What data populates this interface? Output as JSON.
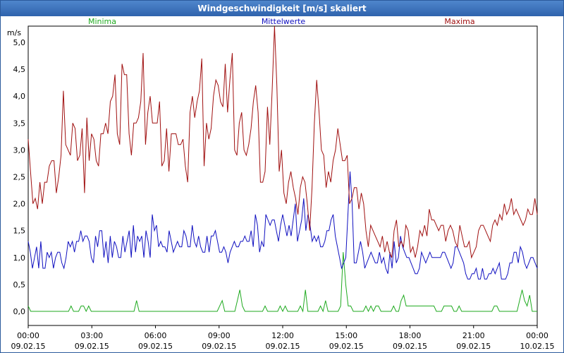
{
  "window": {
    "title": "Windgeschwindigkeit [m/s] skaliert"
  },
  "chart_data": {
    "type": "line",
    "title": "Windgeschwindigkeit [m/s] skaliert",
    "ylabel": "m/s",
    "ylim": [
      0,
      5.5
    ],
    "grid": true,
    "legend_position": "top",
    "y_ticks": [
      "0,0",
      "0,5",
      "1,0",
      "1,5",
      "2,0",
      "2,5",
      "3,0",
      "3,5",
      "4,0",
      "4,5",
      "5,0"
    ],
    "x_ticks": [
      {
        "time": "00:00",
        "date": "09.02.15"
      },
      {
        "time": "03:00",
        "date": "09.02.15"
      },
      {
        "time": "06:00",
        "date": "09.02.15"
      },
      {
        "time": "09:00",
        "date": "09.02.15"
      },
      {
        "time": "12:00",
        "date": "09.02.15"
      },
      {
        "time": "15:00",
        "date": "09.02.15"
      },
      {
        "time": "18:00",
        "date": "09.02.15"
      },
      {
        "time": "21:00",
        "date": "09.02.15"
      },
      {
        "time": "00:00",
        "date": "10.02.15"
      }
    ],
    "x_hours_range": [
      0,
      24
    ],
    "series": [
      {
        "name": "Minima",
        "color": "#1faa1f",
        "values": [
          0.1,
          0,
          0,
          0,
          0,
          0,
          0,
          0,
          0,
          0,
          0,
          0,
          0,
          0,
          0,
          0,
          0,
          0.1,
          0,
          0,
          0,
          0.1,
          0.1,
          0,
          0.1,
          0,
          0,
          0,
          0,
          0,
          0,
          0,
          0,
          0,
          0,
          0,
          0,
          0,
          0,
          0,
          0,
          0,
          0,
          0.2,
          0,
          0,
          0,
          0,
          0,
          0,
          0,
          0,
          0,
          0,
          0,
          0,
          0,
          0,
          0,
          0,
          0,
          0,
          0,
          0,
          0,
          0,
          0,
          0,
          0,
          0,
          0,
          0,
          0,
          0,
          0,
          0,
          0.1,
          0.2,
          0,
          0,
          0,
          0,
          0,
          0.2,
          0.4,
          0.1,
          0,
          0,
          0,
          0,
          0,
          0,
          0,
          0,
          0.1,
          0,
          0,
          0,
          0,
          0,
          0.1,
          0,
          0.1,
          0,
          0,
          0,
          0,
          0,
          0.1,
          0,
          0.4,
          0,
          0,
          0,
          0,
          0,
          0.1,
          0,
          0.2,
          0,
          0,
          0,
          0,
          0,
          0.1,
          1.1,
          0.5,
          0.1,
          0.1,
          0,
          0,
          0,
          0,
          0,
          0.1,
          0,
          0.1,
          0,
          0.1,
          0.1,
          0,
          0,
          0,
          0,
          0,
          0.1,
          0,
          0,
          0.2,
          0.3,
          0.1,
          0.1,
          0.1,
          0.1,
          0.1,
          0.1,
          0.1,
          0.1,
          0.1,
          0.1,
          0.1,
          0.1,
          0,
          0,
          0,
          0.1,
          0.1,
          0.1,
          0.1,
          0,
          0,
          0.1,
          0,
          0,
          0,
          0,
          0,
          0,
          0,
          0,
          0,
          0,
          0,
          0,
          0,
          0.1,
          0.1,
          0,
          0,
          0,
          0,
          0,
          0,
          0,
          0,
          0.2,
          0.4,
          0.2,
          0.1,
          0.3,
          0,
          0,
          0
        ],
        "values_note_hours": [
          0,
          0.125,
          0.25,
          0.375,
          0.5,
          0.625,
          0.75,
          0.875,
          1,
          1.125,
          1.25,
          1.375,
          1.5,
          1.625,
          1.75,
          1.875,
          2,
          2.125,
          2.25,
          2.375,
          2.5,
          2.625,
          2.75,
          2.875,
          3,
          3.125,
          3.25,
          3.375,
          3.5,
          3.625,
          3.75,
          3.875,
          4,
          4.125,
          4.25,
          4.375,
          4.5,
          4.625,
          4.75,
          4.875,
          5,
          5.125,
          5.25,
          5.375,
          5.5,
          5.625,
          5.75,
          5.875,
          6,
          6.125,
          6.25,
          6.375,
          6.5,
          6.625,
          6.75,
          6.875,
          7,
          7.125,
          7.25,
          7.375,
          7.5,
          7.625,
          7.75,
          7.875,
          8,
          8.125,
          8.25,
          8.375,
          8.5,
          8.625,
          8.75,
          8.875,
          9,
          9.125,
          9.25,
          9.375,
          9.5,
          9.625,
          9.75,
          9.875,
          10,
          10.125,
          10.25,
          10.375,
          10.5,
          10.625,
          10.75,
          10.875,
          11,
          11.125,
          11.25,
          11.375,
          11.5,
          11.625,
          11.75,
          11.875,
          12,
          12.125,
          12.25,
          12.375,
          12.5,
          12.625,
          12.75,
          12.875,
          13,
          13.125,
          13.25,
          13.375,
          13.5,
          13.625,
          13.75,
          13.875,
          14,
          14.125,
          14.25,
          14.375,
          14.5,
          14.625,
          14.75,
          14.875,
          15,
          15.125,
          15.25,
          15.375,
          15.5,
          15.625,
          15.75,
          15.875,
          16,
          16.125,
          16.25,
          16.375,
          16.5,
          16.625,
          16.75,
          16.875,
          17,
          17.125,
          17.25,
          17.375,
          17.5,
          17.625,
          17.75,
          17.875,
          18,
          18.125,
          18.25,
          18.375,
          18.5,
          18.625,
          18.75,
          18.875,
          19,
          19.125,
          19.25,
          19.375,
          19.5,
          19.625,
          19.75,
          19.875,
          20,
          20.125,
          20.25,
          20.375,
          20.5,
          20.625,
          20.75,
          20.875,
          21,
          21.125,
          21.25,
          21.375,
          21.5,
          21.625,
          21.75,
          21.875,
          22,
          22.125,
          22.25,
          22.375,
          22.5,
          22.625,
          22.75,
          22.875,
          23,
          23.125,
          23.25,
          23.375,
          23.5,
          23.625,
          23.75,
          23.875,
          24
        ]
      },
      {
        "name": "Mittelwerte",
        "color": "#1010c0",
        "values": [
          1.3,
          1.1,
          0.8,
          1.0,
          1.2,
          0.8,
          1.3,
          0.8,
          0.8,
          1.1,
          1.0,
          1.1,
          0.8,
          1.0,
          1.1,
          1.1,
          0.9,
          0.8,
          1.0,
          1.3,
          1.2,
          1.3,
          1.1,
          1.3,
          1.3,
          1.5,
          1.3,
          1.4,
          1.4,
          1.3,
          1.0,
          0.9,
          1.4,
          1.2,
          1.5,
          1.5,
          1.0,
          1.3,
          0.9,
          1.4,
          1.0,
          1.3,
          1.2,
          1.0,
          1.0,
          1.4,
          1.1,
          1.3,
          1.5,
          1.0,
          1.6,
          1.1,
          1.4,
          1.3,
          1.4,
          1.0,
          1.5,
          1.3,
          1.0,
          1.8,
          1.5,
          1.6,
          1.2,
          1.3,
          1.2,
          1.2,
          1.1,
          1.5,
          1.3,
          1.1,
          1.2,
          1.3,
          1.2,
          1.2,
          1.5,
          1.4,
          1.2,
          1.2,
          1.6,
          1.3,
          1.2,
          1.4,
          1.2,
          1.1,
          1.1,
          1.4,
          1.1,
          1.4,
          1.4,
          1.5,
          1.3,
          1.1,
          1.1,
          1.2,
          1.1,
          0.9,
          1.1,
          1.2,
          1.3,
          1.2,
          1.2,
          1.3,
          1.3,
          1.4,
          1.3,
          1.3,
          1.5,
          1.2,
          1.8,
          1.6,
          1.1,
          1.3,
          1.2,
          1.8,
          1.7,
          1.6,
          1.7,
          1.7,
          1.5,
          1.3,
          1.6,
          1.8,
          1.6,
          1.4,
          1.6,
          1.4,
          1.7,
          2.0,
          1.3,
          1.5,
          1.7,
          2.1,
          1.5,
          1.8,
          1.6,
          1.3,
          1.4,
          1.3,
          1.4,
          1.2,
          1.2,
          1.3,
          1.5,
          1.5,
          1.7,
          1.8,
          1.4,
          1.2,
          1.0,
          0.8,
          0.9,
          1.0,
          1.8,
          2.6,
          2.0,
          0.9,
          0.9,
          1.1,
          1.3,
          1.1,
          0.8,
          0.9,
          1.0,
          1.1,
          1.0,
          0.9,
          0.9,
          1.1,
          0.9,
          1.0,
          0.8,
          0.7,
          1.1,
          0.8,
          1.3,
          0.9,
          1.0,
          1.4,
          1.2,
          1.1,
          1.0,
          1.0,
          0.9,
          0.8,
          0.7,
          0.7,
          0.8,
          1.1,
          1.0,
          0.9,
          1.0,
          1.1,
          1.0,
          1.0,
          1.0,
          1.0,
          1.0,
          1.1,
          1.1,
          1.0,
          0.9,
          0.8,
          0.9,
          1.2,
          1.2,
          1.1,
          1.0,
          0.9,
          0.7,
          0.6,
          0.6,
          0.7,
          0.7,
          0.8,
          0.6,
          0.6,
          0.8,
          0.6,
          0.6,
          0.7,
          0.7,
          0.8,
          0.7,
          0.8,
          0.9,
          0.6,
          0.6,
          0.6,
          0.7,
          0.9,
          0.9,
          1.1,
          1.1,
          0.9,
          1.2,
          1.1,
          0.9,
          0.8,
          0.9,
          1.0,
          1.0,
          0.9,
          0.8
        ]
      },
      {
        "name": "Maxima",
        "color": "#a01010",
        "values": [
          3.2,
          2.6,
          2.0,
          2.1,
          1.9,
          2.4,
          2.0,
          2.4,
          2.4,
          2.7,
          2.8,
          2.8,
          2.2,
          2.5,
          2.9,
          4.1,
          3.1,
          3.0,
          2.9,
          3.5,
          3.4,
          2.8,
          2.9,
          3.4,
          2.2,
          3.6,
          2.8,
          3.3,
          3.2,
          2.8,
          2.7,
          3.3,
          3.3,
          3.5,
          3.3,
          3.9,
          4.0,
          4.4,
          3.3,
          3.1,
          4.6,
          4.4,
          4.4,
          3.3,
          2.9,
          3.5,
          3.5,
          3.6,
          3.9,
          4.8,
          3.1,
          3.7,
          4.0,
          3.5,
          3.5,
          3.5,
          3.9,
          2.7,
          2.8,
          3.4,
          2.6,
          3.3,
          3.3,
          3.3,
          3.1,
          3.1,
          3.2,
          2.7,
          2.4,
          3.7,
          4.0,
          3.6,
          3.9,
          4.1,
          4.7,
          2.7,
          3.5,
          3.2,
          3.4,
          4.0,
          4.3,
          4.2,
          3.9,
          3.8,
          4.6,
          3.7,
          4.3,
          4.8,
          3.0,
          2.9,
          3.5,
          3.7,
          3.0,
          2.9,
          3.1,
          3.4,
          3.9,
          4.2,
          3.7,
          2.4,
          2.4,
          2.6,
          3.8,
          3.1,
          4.1,
          5.3,
          4.2,
          2.6,
          3.0,
          2.2,
          2.0,
          2.4,
          2.6,
          2.3,
          2.1,
          1.8,
          2.3,
          2.5,
          2.4,
          2.0,
          1.5,
          2.3,
          3.5,
          4.3,
          3.7,
          3.0,
          2.9,
          2.3,
          2.6,
          2.4,
          2.8,
          3.0,
          3.4,
          3.1,
          2.8,
          2.8,
          2.9,
          2.0,
          2.1,
          2.3,
          2.3,
          1.9,
          2.2,
          2.0,
          1.5,
          1.2,
          1.6,
          1.5,
          1.4,
          1.3,
          1.2,
          1.4,
          1.1,
          1.3,
          1.1,
          1.0,
          1.5,
          1.7,
          1.2,
          1.3,
          1.2,
          1.6,
          1.5,
          1.1,
          1.2,
          1.0,
          1.2,
          1.5,
          1.4,
          1.6,
          1.4,
          1.9,
          1.7,
          1.7,
          1.6,
          1.5,
          1.6,
          1.6,
          1.3,
          1.5,
          1.6,
          1.5,
          1.3,
          1.2,
          1.6,
          1.4,
          1.2,
          1.2,
          1.3,
          1.0,
          1.1,
          1.2,
          1.5,
          1.6,
          1.6,
          1.5,
          1.4,
          1.3,
          1.6,
          1.7,
          1.6,
          1.8,
          1.7,
          2.0,
          1.8,
          1.9,
          2.1,
          1.8,
          1.9,
          1.8,
          1.7,
          1.6,
          1.7,
          1.9,
          1.8,
          1.8,
          2.1,
          1.8
        ]
      }
    ]
  }
}
